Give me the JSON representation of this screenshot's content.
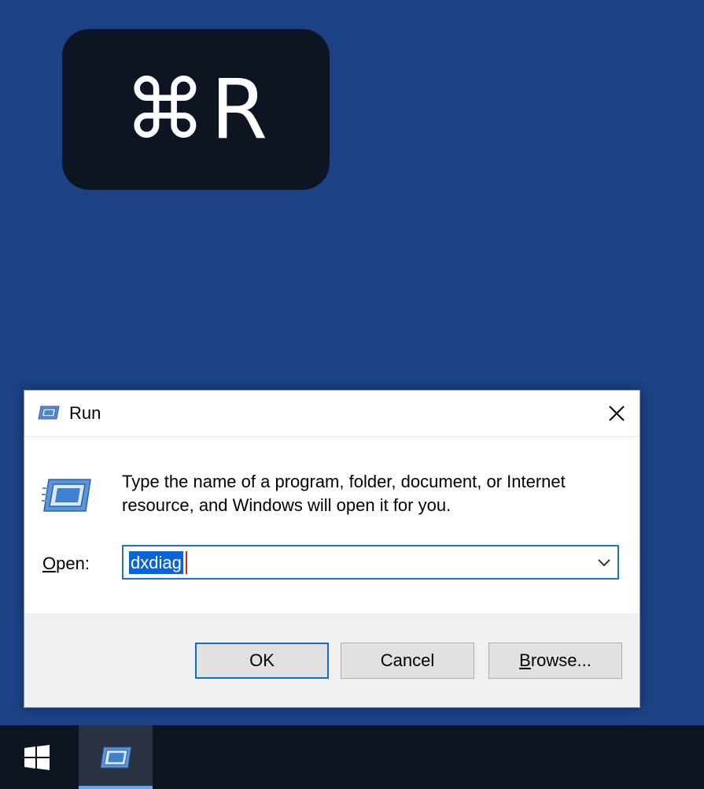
{
  "shortcut": {
    "symbol": "⌘",
    "key": "R"
  },
  "dialog": {
    "title": "Run",
    "icon": "run-icon",
    "close_icon": "close-icon",
    "description": "Type the name of a program, folder, document, or Internet resource, and Windows will open it for you.",
    "open_label_accel": "O",
    "open_label_rest": "pen:",
    "open_value": "dxdiag",
    "dropdown_icon": "chevron-down-icon",
    "buttons": {
      "ok": "OK",
      "cancel": "Cancel",
      "browse_accel": "B",
      "browse_rest": "rowse..."
    }
  },
  "taskbar": {
    "start_icon": "windows-logo-icon",
    "running_app_icon": "run-icon"
  },
  "colors": {
    "desktop": "#1c4185",
    "accent": "#0a6cd6",
    "selection": "#0c63d3",
    "taskbar": "#0e1420"
  }
}
